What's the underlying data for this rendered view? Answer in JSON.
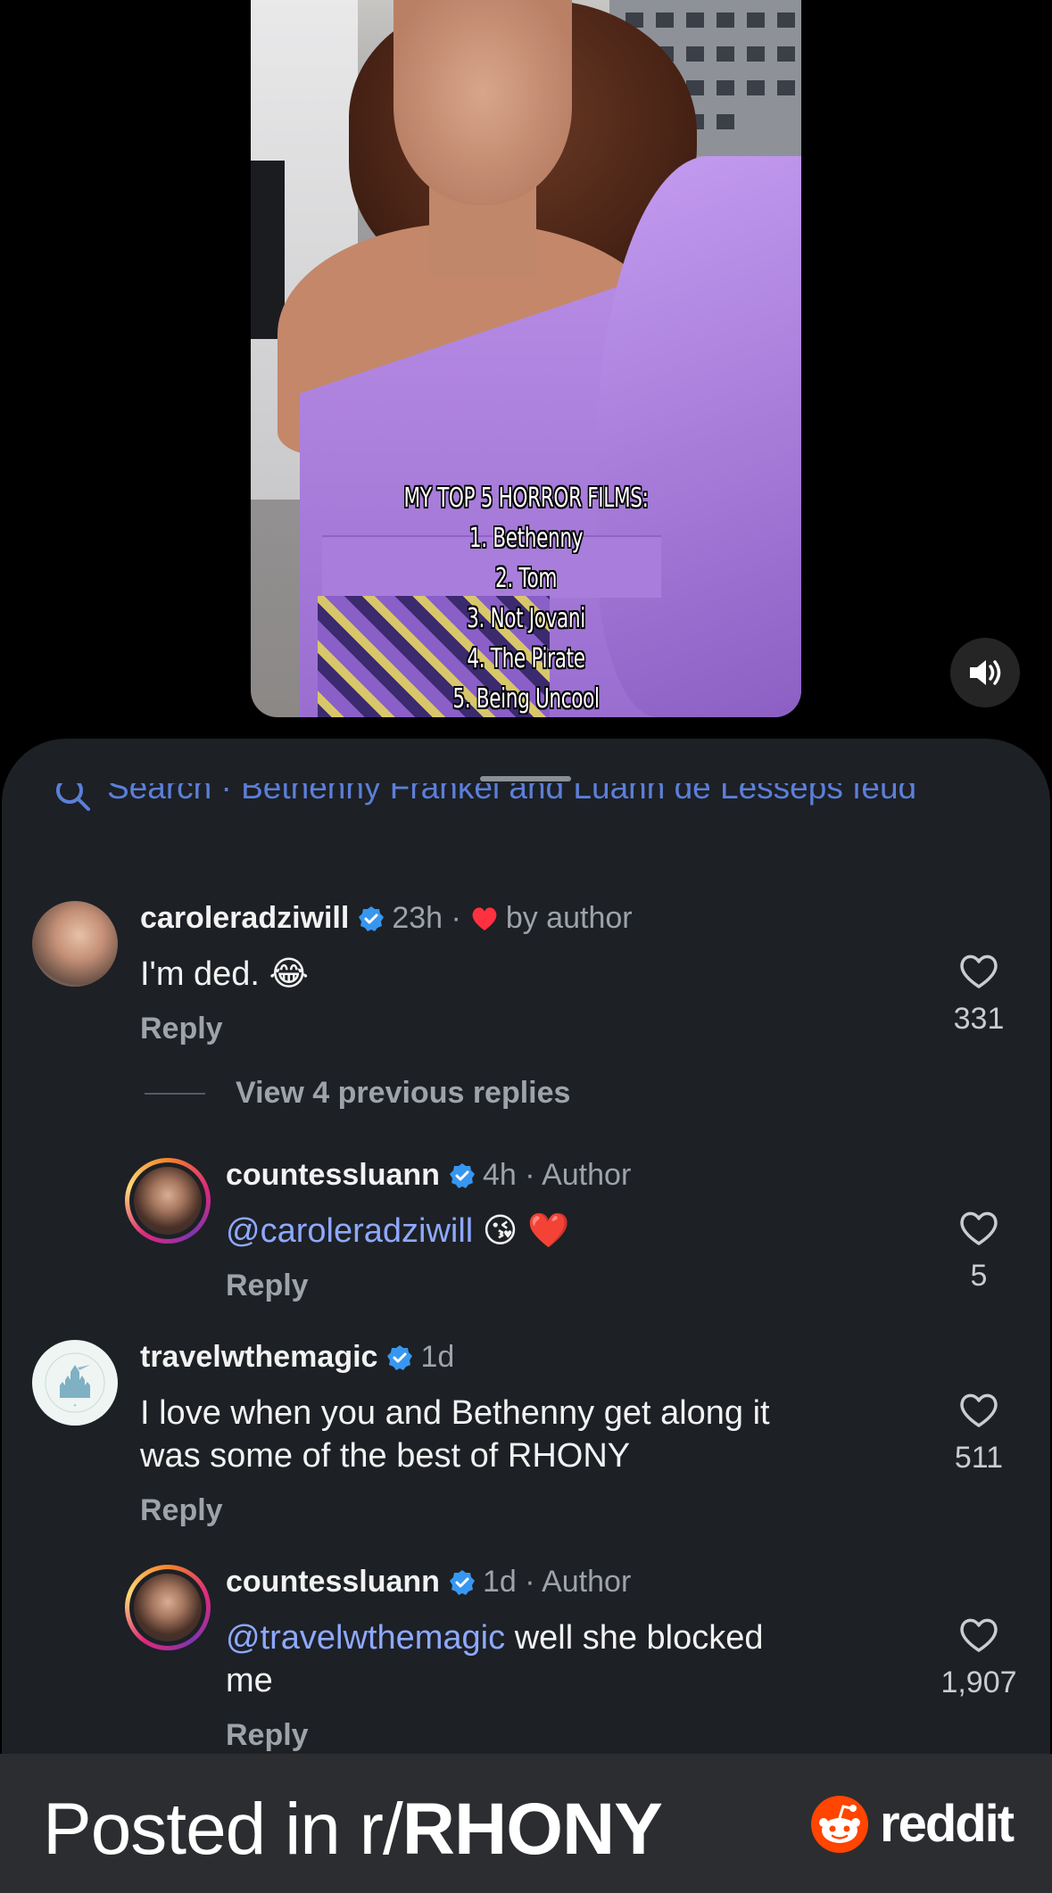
{
  "video": {
    "overlay_lines": [
      "MY TOP 5 HORROR FILMS:",
      "1. Bethenny",
      "2. Tom",
      "3. Not Jovani",
      "4. The Pirate",
      "5. Being Uncool"
    ]
  },
  "search": {
    "placeholder": "Search · Bethenny Frankel and Luann de Lesseps feud"
  },
  "comments": [
    {
      "username": "caroleradziwill",
      "meta": "23h ·",
      "badge": "by author",
      "text": "I'm ded. 😂",
      "reply": "Reply",
      "likes": "331"
    },
    {
      "view_replies": "View 4 previous replies"
    },
    {
      "username": "countessluann",
      "meta": "4h · Author",
      "mention": "@caroleradziwill",
      "text": " 😘 ❤️",
      "reply": "Reply",
      "likes": "5"
    },
    {
      "username": "travelwthemagic",
      "meta": "1d",
      "text_line1": "I love when you and Bethenny get along it",
      "text_line2": "was some of the best of RHONY",
      "reply": "Reply",
      "likes": "511"
    },
    {
      "username": "countessluann",
      "meta": "1d · Author",
      "mention": "@travelwthemagic",
      "text_line1": " well she blocked",
      "text_line2": "me",
      "reply": "Reply",
      "likes": "1,907"
    }
  ],
  "footer": {
    "posted_prefix": "Posted in r/",
    "subreddit": "RHONY",
    "brand": "reddit"
  },
  "colors": {
    "sheet_bg": "#1d2025",
    "mention": "#8ea9ff",
    "verified": "#3797f0",
    "heart_red": "#ff3040",
    "reddit_orange": "#ff4500"
  }
}
